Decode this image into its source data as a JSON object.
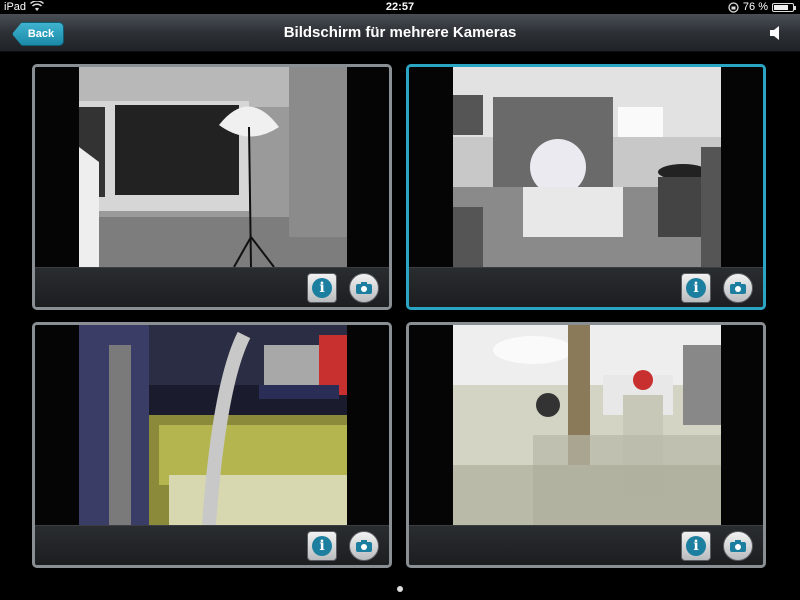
{
  "status_bar": {
    "device": "iPad",
    "time": "22:57",
    "battery": "76 %",
    "battery_level": 0.76
  },
  "nav": {
    "back_label": "Back",
    "title": "Bildschirm für mehrere Kameras",
    "speaker_icon": "speaker-icon"
  },
  "cameras": [
    {
      "id": "camera-1",
      "selected": false,
      "info_icon": "info-icon",
      "snapshot_icon": "camera-icon"
    },
    {
      "id": "camera-2",
      "selected": true,
      "info_icon": "info-icon",
      "snapshot_icon": "camera-icon"
    },
    {
      "id": "camera-3",
      "selected": false,
      "info_icon": "info-icon",
      "snapshot_icon": "camera-icon"
    },
    {
      "id": "camera-4",
      "selected": false,
      "info_icon": "info-icon",
      "snapshot_icon": "camera-icon"
    }
  ],
  "page_indicator": {
    "pages": 1,
    "current": 1
  },
  "colors": {
    "accent": "#2aa6c4",
    "tile_border": "#8a8f94",
    "nav_bar": "#2d3136"
  }
}
